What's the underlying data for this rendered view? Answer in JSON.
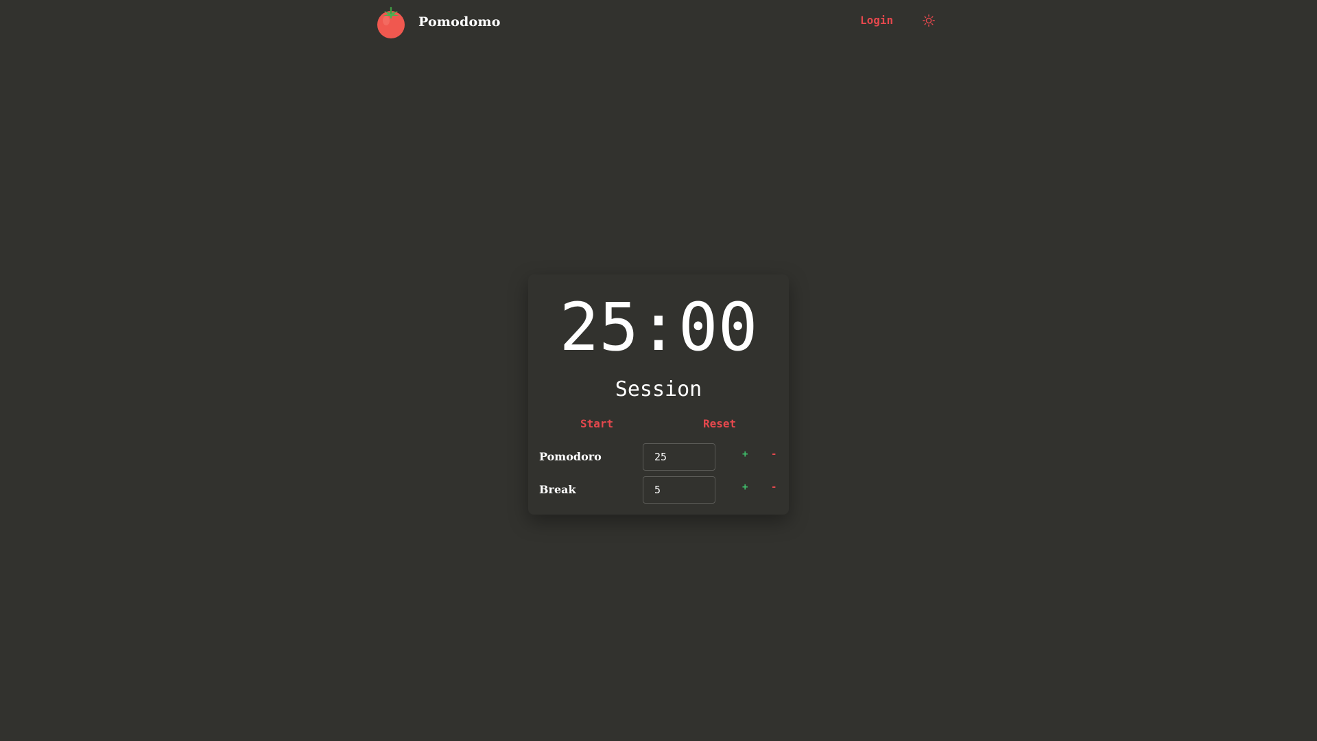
{
  "app": {
    "name": "Pomodomo",
    "logo_icon": "tomato-icon"
  },
  "nav": {
    "login_label": "Login",
    "theme_toggle_icon": "sun-icon"
  },
  "timer": {
    "time": "25:00",
    "mode": "Session",
    "start_label": "Start",
    "reset_label": "Reset"
  },
  "settings": [
    {
      "label": "Pomodoro",
      "value": "25",
      "increment": "+",
      "decrement": "-"
    },
    {
      "label": "Break",
      "value": "5",
      "increment": "+",
      "decrement": "-"
    }
  ],
  "colors": {
    "background": "#32322e",
    "accent": "#e5484d",
    "increment": "#3fbf6b",
    "text": "#ffffff"
  }
}
